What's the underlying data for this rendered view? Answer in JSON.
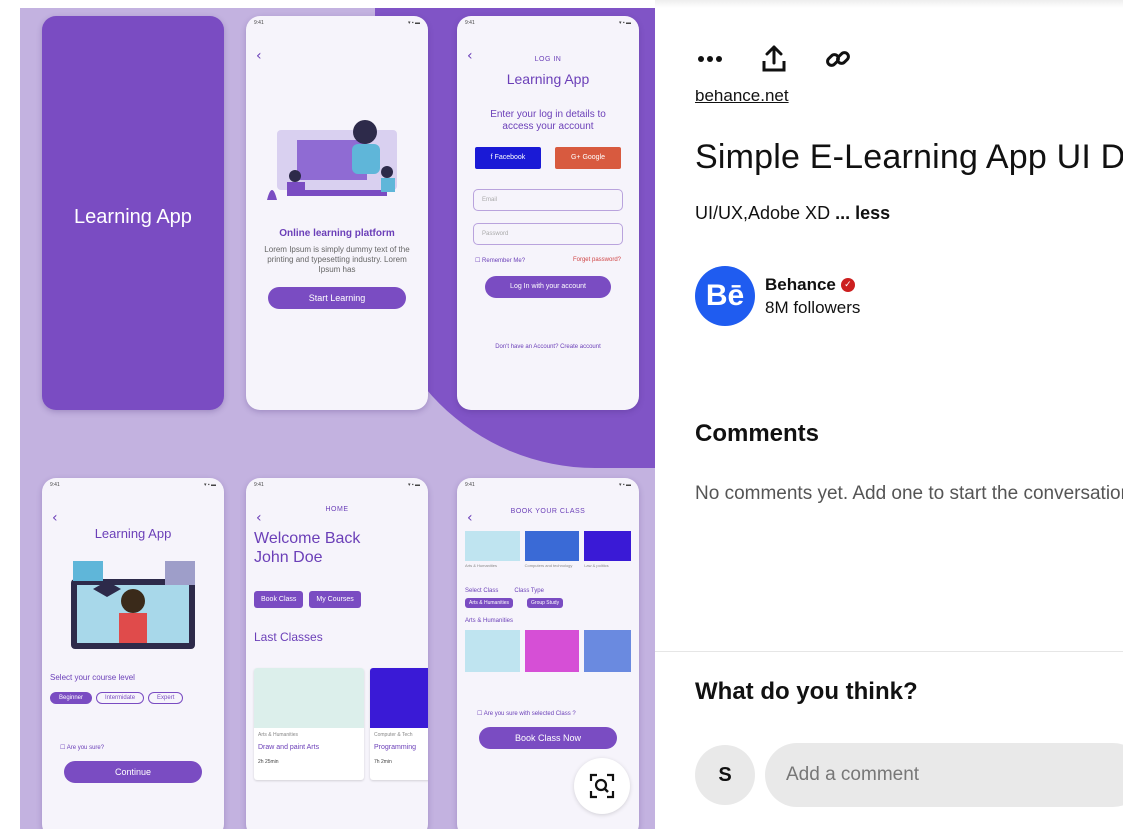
{
  "pin_image": {
    "screens": {
      "splash": {
        "title": "Learning App"
      },
      "onboarding": {
        "heading": "Online learning platform",
        "text": "Lorem Ipsum is simply dummy text of the printing and typesetting industry. Lorem Ipsum has",
        "button": "Start Learning"
      },
      "login": {
        "small": "LOG IN",
        "title": "Learning App",
        "prompt": "Enter your log in details to access your account",
        "facebook": "Facebook",
        "google": "Google",
        "email": "Email",
        "password": "Password",
        "remember": "Remember Me?",
        "forgot": "Forget password?",
        "button": "Log In with your account",
        "signup": "Don't have an Account? Create account"
      },
      "level": {
        "title": "Learning App",
        "prompt": "Select your course level",
        "chips": [
          "Beginner",
          "Intermidate",
          "Expert"
        ],
        "confirm": "Are you sure?",
        "button": "Continue"
      },
      "home": {
        "small": "HOME",
        "welcome": "Welcome Back John Doe",
        "book": "Book Class",
        "courses": "My Courses",
        "last": "Last Classes",
        "card1": {
          "cat": "Arts & Humanities",
          "title": "Draw and paint Arts",
          "dur": "2h 25min"
        },
        "card2": {
          "cat": "Computer & Tech",
          "title": "Programming",
          "dur": "7h 2min"
        }
      },
      "book": {
        "small": "BOOK YOUR CLASS",
        "cats": [
          "Arts & Humanities",
          "Computers and technology",
          "Law & politics"
        ],
        "select_class": "Select Class",
        "class_type": "Class Type",
        "class_value": "Arts & Humanities",
        "type_value": "Group Study",
        "section": "Arts & Humanities",
        "confirm": "Are you sure with selected Class ?",
        "button": "Book Class Now"
      }
    }
  },
  "actions": {
    "more": "more-icon",
    "share": "share-icon",
    "link": "link-icon"
  },
  "pin": {
    "source": "behance.net",
    "title": "Simple E-Learning App UI Design",
    "description": "UI/UX,Adobe XD",
    "less": "... less"
  },
  "creator": {
    "avatar_text": "Bē",
    "name": "Behance",
    "followers": "8M followers"
  },
  "comments": {
    "heading": "Comments",
    "empty": "No comments yet. Add one to start the conversation.",
    "prompt": "What do you think?",
    "user_initial": "S",
    "placeholder": "Add a comment"
  },
  "colors": {
    "accent": "#7a4cc2",
    "creator_blue": "#1f5cf0",
    "verified_red": "#cc1f1f"
  }
}
